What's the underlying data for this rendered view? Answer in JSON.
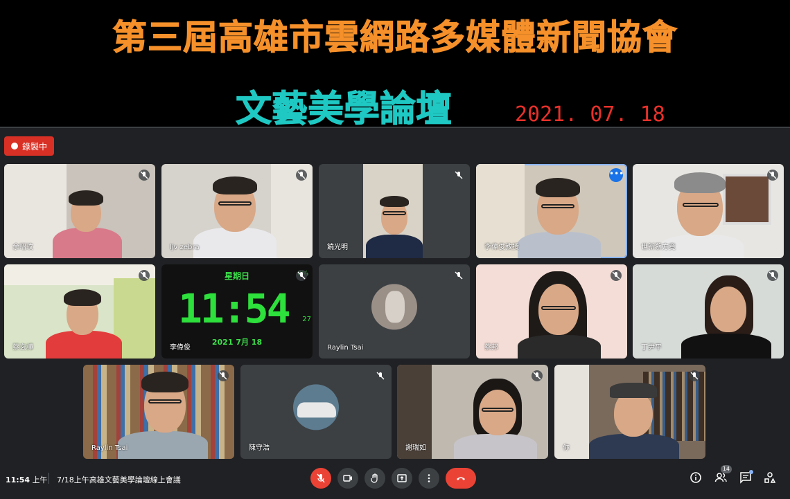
{
  "banner": {
    "title": "第三屆高雄市雲網路多媒體新聞協會",
    "subtitle": "文藝美學論壇",
    "date": "2021. 07. 18"
  },
  "recording": {
    "label": "錄製中"
  },
  "participants": [
    {
      "name": "余昭玟"
    },
    {
      "name": "ljv zebra"
    },
    {
      "name": "饒光明"
    },
    {
      "name": "李偉俊教授"
    },
    {
      "name": "世新蔡方竟"
    },
    {
      "name": "蔡玄樺"
    },
    {
      "name": "李偉俊"
    },
    {
      "name": "Raylin Tsai"
    },
    {
      "name": "蔡邦"
    },
    {
      "name": "丁尹平"
    },
    {
      "name": "Raylin Tsai"
    },
    {
      "name": "陳守浩"
    },
    {
      "name": "謝瑞如"
    },
    {
      "name": "你"
    }
  ],
  "clock": {
    "day": "星期日",
    "time": "11:54",
    "seconds": "27",
    "percent": "0%",
    "date": "2021 7月 18"
  },
  "bottom_bar": {
    "time": "11:54",
    "ampm": "上午",
    "meeting_name": "7/18上午高雄文藝美學論壇線上會議",
    "participant_count": "14"
  },
  "colors": {
    "title": "#f5902a",
    "subtitle": "#1fc8c3",
    "date": "#e8302a",
    "meet_bg": "#202124",
    "tile_bg": "#3c4043",
    "danger": "#ea4335",
    "accent": "#8ab4f8"
  },
  "icons": {
    "mic_off": "mic-off-icon",
    "camera": "video-icon",
    "hand": "hand-icon",
    "present": "present-icon",
    "more": "more-vert-icon",
    "end": "phone-hangup-icon",
    "info": "info-icon",
    "people": "people-icon",
    "chat": "chat-icon",
    "activities": "activities-icon"
  }
}
